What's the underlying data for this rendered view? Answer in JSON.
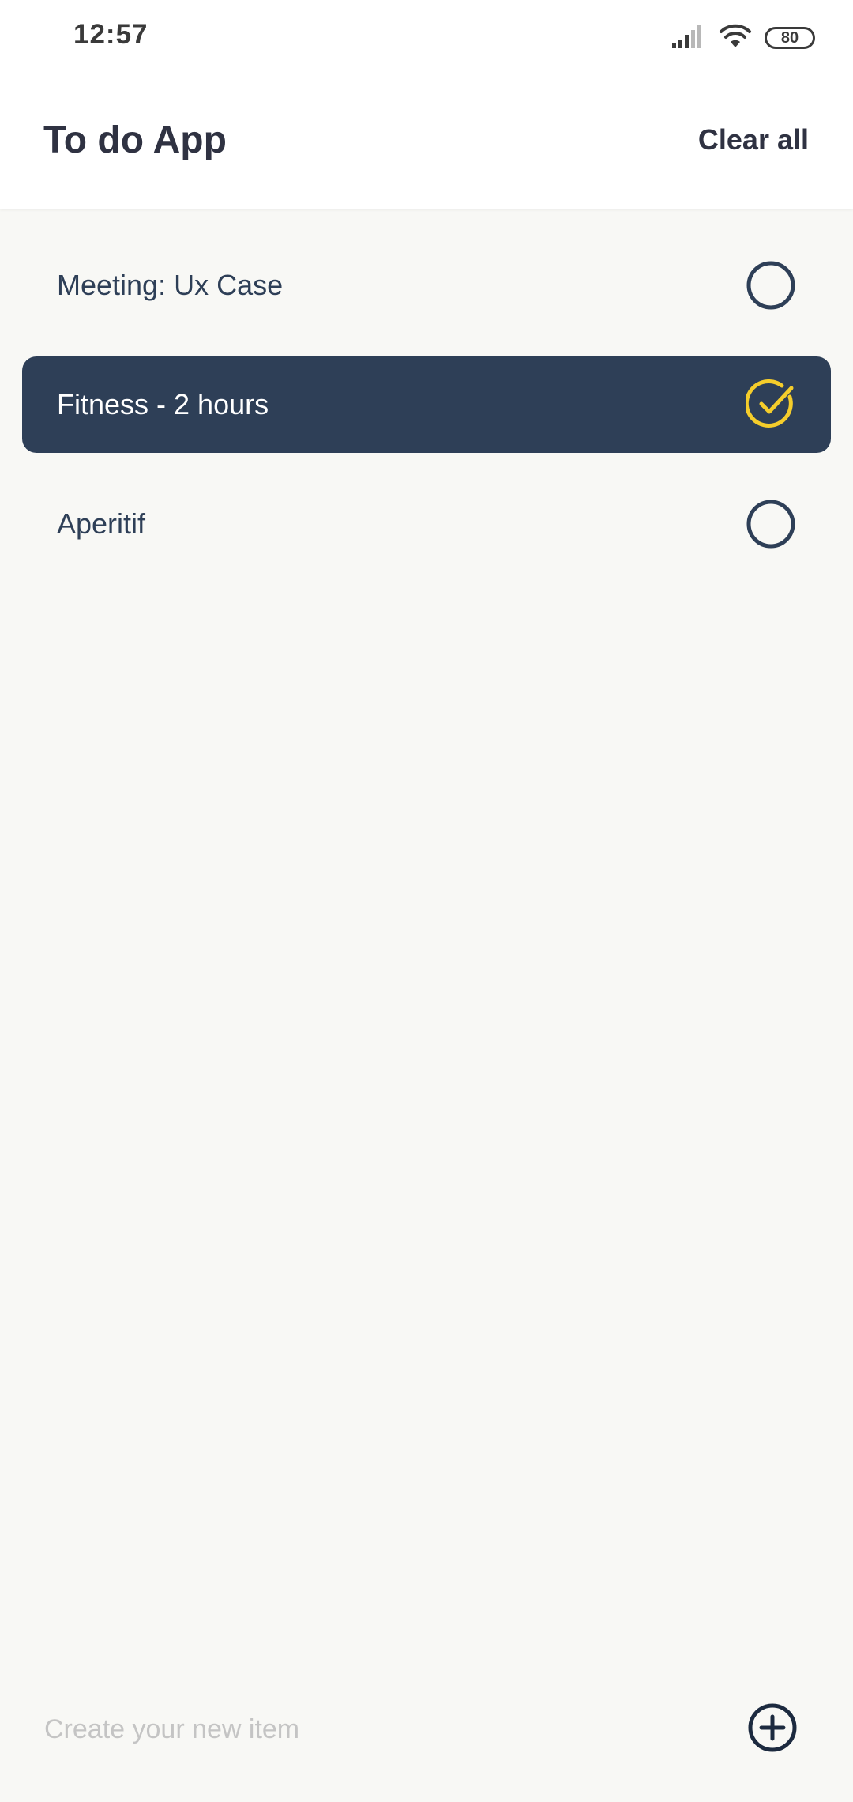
{
  "status_bar": {
    "time": "12:57",
    "battery": "80",
    "icons": [
      "signal-icon",
      "wifi-icon",
      "battery-icon"
    ]
  },
  "header": {
    "title": "To do App",
    "clear_all_label": "Clear all"
  },
  "todos": [
    {
      "label": "Meeting: Ux Case",
      "done": false
    },
    {
      "label": "Fitness - 2 hours",
      "done": true
    },
    {
      "label": "Aperitif",
      "done": false
    }
  ],
  "new_item": {
    "placeholder": "Create your new item",
    "value": ""
  },
  "colors": {
    "background": "#f8f8f5",
    "header_bg": "#ffffff",
    "text_dark": "#2f3242",
    "item_text": "#2e3f57",
    "done_bg": "#2e3f57",
    "done_check": "#f5cd2b",
    "placeholder": "#c4c4c4"
  }
}
